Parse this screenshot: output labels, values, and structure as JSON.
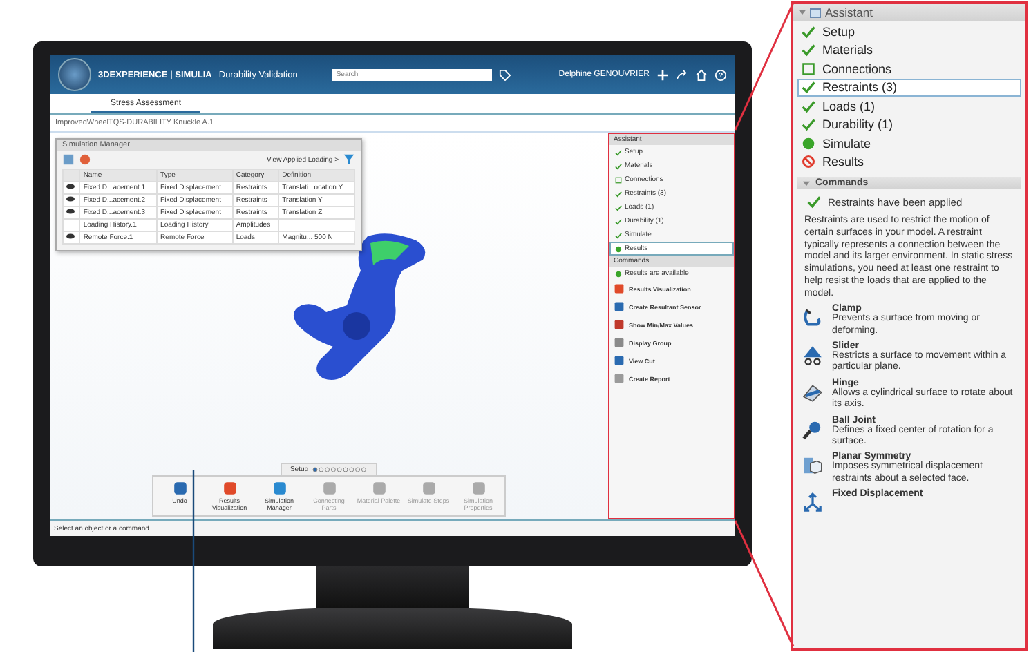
{
  "screen": {
    "title_brand": "3DEXPERIENCE | SIMULIA",
    "title_app": "Durability Validation",
    "search": {
      "placeholder": "Search"
    },
    "user": "Delphine GENOUVRIER",
    "tabs": [
      {
        "label": "Stress Assessment",
        "selected": true
      }
    ],
    "breadcrumb": "ImprovedWheelTQS-DURABILITY Knuckle A.1",
    "simulation_manager": {
      "title": "Simulation Manager",
      "view_link": "View Applied Loading >",
      "columns": [
        "Name",
        "Type",
        "Category",
        "Definition"
      ],
      "rows": [
        {
          "visible": true,
          "cells": [
            "Fixed D...acement.1",
            "Fixed Displacement",
            "Restraints",
            "Translati...ocation Y"
          ]
        },
        {
          "visible": true,
          "cells": [
            "Fixed D...acement.2",
            "Fixed Displacement",
            "Restraints",
            "Translation Y"
          ]
        },
        {
          "visible": true,
          "cells": [
            "Fixed D...acement.3",
            "Fixed Displacement",
            "Restraints",
            "Translation Z"
          ]
        },
        {
          "visible": false,
          "cells": [
            "Loading History.1",
            "Loading History",
            "Amplitudes"
          ]
        },
        {
          "visible": true,
          "cells": [
            "Remote Force.1",
            "Remote Force",
            "Loads",
            "Magnitu... 500 N"
          ]
        }
      ]
    },
    "assistant": {
      "title": "Assistant",
      "steps": [
        {
          "label": "Setup",
          "kind": "done",
          "selected": false
        },
        {
          "label": "Materials",
          "kind": "done",
          "selected": false
        },
        {
          "label": "Connections",
          "kind": "todo",
          "selected": false
        },
        {
          "label": "Restraints (3)",
          "kind": "done",
          "selected": false
        },
        {
          "label": "Loads (1)",
          "kind": "done",
          "selected": false
        },
        {
          "label": "Durability (1)",
          "kind": "done",
          "selected": false
        },
        {
          "label": "Simulate",
          "kind": "done",
          "selected": false
        },
        {
          "label": "Results",
          "kind": "current",
          "selected": true
        }
      ],
      "commands_title": "Commands",
      "status": "Results are available",
      "commands": [
        "Results Visualization",
        "Create Resultant Sensor",
        "Show Min/Max Values",
        "Display Group",
        "View Cut",
        "Create Report"
      ]
    },
    "toolbar": {
      "section": "Setup",
      "buttons": [
        {
          "label": "Undo",
          "disabled": false
        },
        {
          "label": "Results Visualization",
          "disabled": false
        },
        {
          "label": "Simulation Manager",
          "disabled": false
        },
        {
          "label": "Connecting Parts",
          "disabled": true
        },
        {
          "label": "Material Palette",
          "disabled": true
        },
        {
          "label": "Simulate Steps",
          "disabled": true
        },
        {
          "label": "Simulation Properties",
          "disabled": true
        }
      ]
    },
    "status_bar": "Select an object or a command"
  },
  "callout": {
    "title": "Assistant",
    "steps": [
      {
        "label": "Setup",
        "kind": "done",
        "selected": false
      },
      {
        "label": "Materials",
        "kind": "done",
        "selected": false
      },
      {
        "label": "Connections",
        "kind": "todo",
        "selected": false
      },
      {
        "label": "Restraints (3)",
        "kind": "done",
        "selected": true
      },
      {
        "label": "Loads (1)",
        "kind": "done",
        "selected": false
      },
      {
        "label": "Durability (1)",
        "kind": "done",
        "selected": false
      },
      {
        "label": "Simulate",
        "kind": "current",
        "selected": false
      },
      {
        "label": "Results",
        "kind": "blocked",
        "selected": false
      }
    ],
    "commands_title": "Commands",
    "status": "Restraints have been applied",
    "description": "Restraints are used to restrict the motion of certain surfaces in your model. A restraint typically represents a connection between the model and its larger environment. In static stress simulations, you need at least one restraint to help resist the loads that are applied to the model.",
    "commands": [
      {
        "kind": "clamp",
        "name": "Clamp",
        "text": "Prevents a surface from moving or deforming."
      },
      {
        "kind": "slider",
        "name": "Slider",
        "text": "Restricts a surface to movement within a particular plane."
      },
      {
        "kind": "hinge",
        "name": "Hinge",
        "text": "Allows a cylindrical surface to rotate about its axis."
      },
      {
        "kind": "ball",
        "name": "Ball Joint",
        "text": "Defines a fixed center of rotation for a surface."
      },
      {
        "kind": "symmetry",
        "name": "Planar Symmetry",
        "text": "Imposes symmetrical displacement restraints about a selected face."
      },
      {
        "kind": "fixed",
        "name": "Fixed Displacement"
      }
    ]
  }
}
